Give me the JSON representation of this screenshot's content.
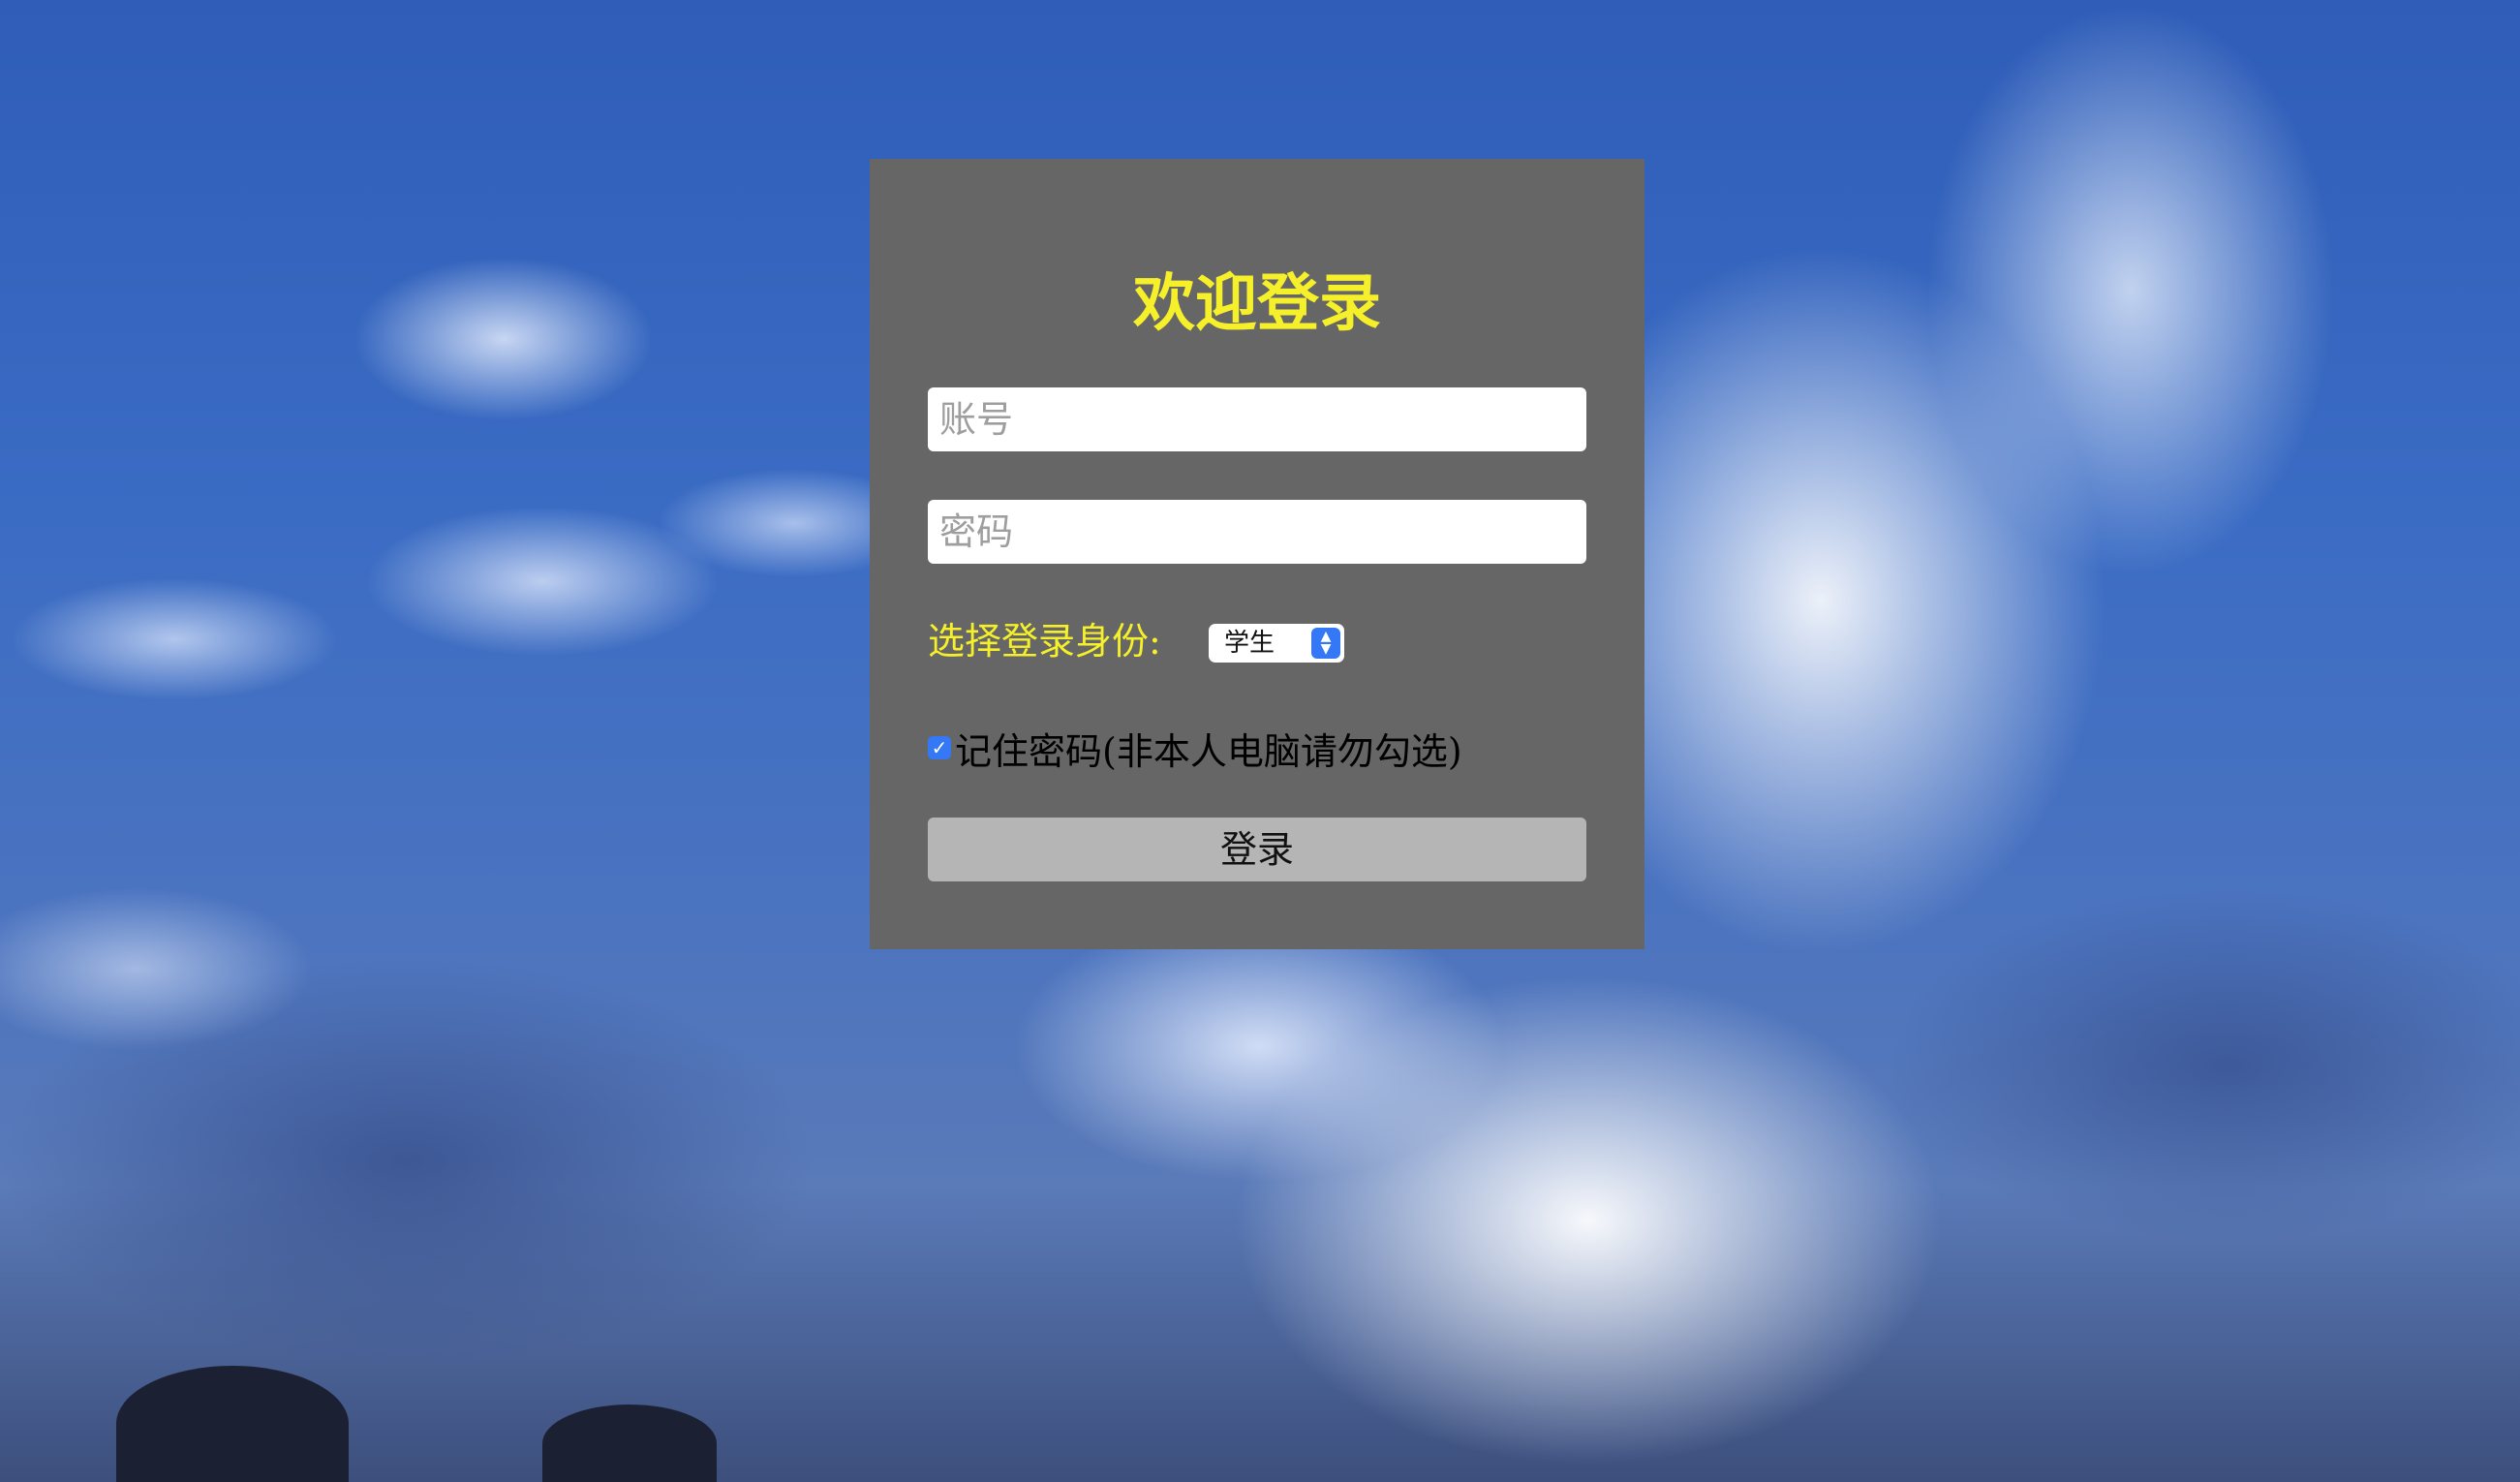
{
  "login": {
    "title": "欢迎登录",
    "account_placeholder": "账号",
    "password_placeholder": "密码",
    "role_label": "选择登录身份:",
    "role_selected": "学生",
    "remember_label": "记住密码(非本人电脑请勿勾选)",
    "remember_checked": true,
    "submit_label": "登录"
  },
  "colors": {
    "panel_bg": "#666666",
    "title_color": "#f5f02a",
    "button_bg": "#b5b5b5",
    "accent": "#3478f6"
  },
  "icons": {
    "select_arrows": "chevron-up-down-icon",
    "checkbox": "checkmark-icon"
  }
}
